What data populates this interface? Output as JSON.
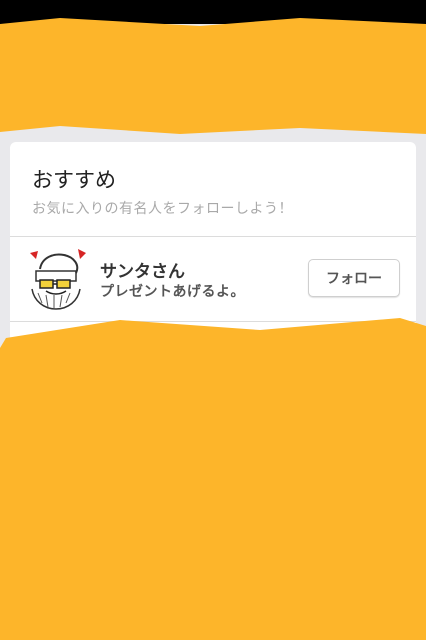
{
  "colors": {
    "redaction": "#FDB52A",
    "page_background": "#E9E9EC"
  },
  "recommend": {
    "title": "おすすめ",
    "subtitle": "お気に入りの有名人をフォローしよう！"
  },
  "user": {
    "name": "サンタさん",
    "bio": "プレゼントあげるよ。",
    "follow_label": "フォロー",
    "avatar_icon": "santa-drawing-icon"
  }
}
